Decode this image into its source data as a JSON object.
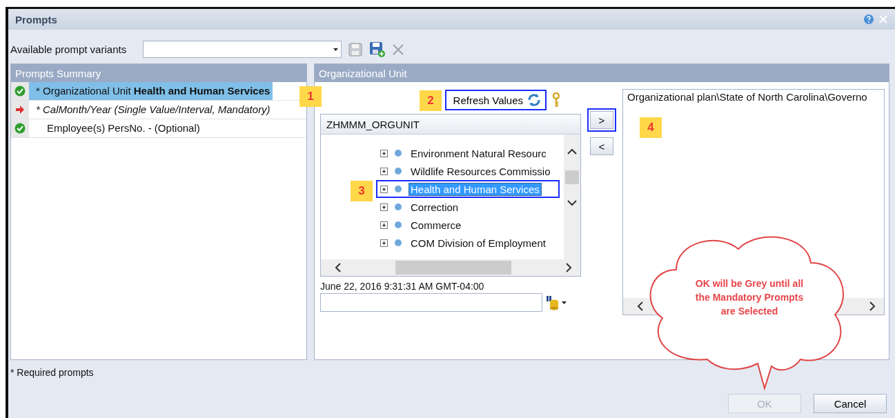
{
  "window": {
    "title": "Prompts"
  },
  "variants": {
    "label": "Available prompt variants"
  },
  "summary": {
    "title": "Prompts Summary",
    "items": [
      {
        "kind": "done",
        "text": "* Organizational Unit **Health and Human Services**",
        "selected": true
      },
      {
        "kind": "pending",
        "text": "* CalMonth/Year (Single Value/Interval, Mandatory)",
        "selected": false
      },
      {
        "kind": "done",
        "text": "Employee(s) PersNo. - (Optional)",
        "selected": false
      }
    ]
  },
  "org_unit": {
    "title": "Organizational Unit",
    "refresh": {
      "label": "Refresh Values",
      "highlighted": true
    },
    "tree": {
      "column": "ZHMMM_ORGUNIT",
      "items": [
        {
          "label": "Environment Natural Resourc",
          "selected": false,
          "highlighted": false
        },
        {
          "label": "Wildlife Resources Commissio",
          "selected": false,
          "highlighted": false
        },
        {
          "label": "Health and Human Services",
          "selected": true,
          "highlighted": true
        },
        {
          "label": "Correction",
          "selected": false,
          "highlighted": false
        },
        {
          "label": "Commerce",
          "selected": false,
          "highlighted": false
        },
        {
          "label": "COM Division of Employment",
          "selected": false,
          "highlighted": false
        }
      ]
    },
    "timestamp": "June 22, 2016 9:31:31 AM GMT-04:00",
    "move_buttons": [
      {
        "label": ">",
        "highlighted": true
      },
      {
        "label": "<",
        "highlighted": false
      }
    ],
    "selected_values": [
      "Organizational plan\\State of North Carolina\\Governo"
    ]
  },
  "annotations": [
    {
      "label": "1"
    },
    {
      "label": "2"
    },
    {
      "label": "3"
    },
    {
      "label": "4"
    }
  ],
  "callout": {
    "text": "OK will be Grey until all the Mandatory Prompts are Selected"
  },
  "footer": {
    "note": "* Required prompts"
  },
  "buttons": [
    {
      "label": "OK",
      "disabled": true
    },
    {
      "label": "Cancel",
      "disabled": false
    }
  ]
}
